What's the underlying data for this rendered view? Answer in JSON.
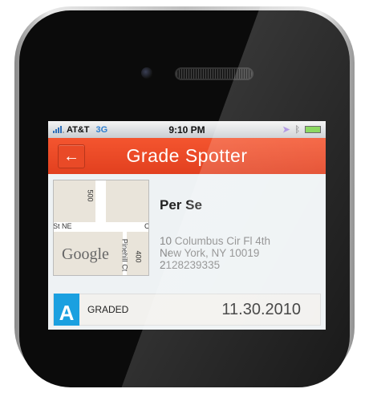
{
  "status_bar": {
    "carrier": "AT&T",
    "network": "3G",
    "time": "9:10 PM",
    "icons": [
      "signal-icon",
      "location-arrow-icon",
      "bluetooth-icon",
      "battery-charging-icon"
    ]
  },
  "header": {
    "title": "Grade Spotter",
    "back_icon": "arrow-left-icon",
    "color": "#e94a27"
  },
  "restaurant": {
    "name": "Per Se",
    "address_line1": "10 Columbus Cir Fl 4th",
    "address_line2": "New York, NY 10019",
    "phone": "2128239335",
    "map": {
      "labels": [
        "500",
        "St NE",
        "Pinehill Ct",
        "400",
        "C"
      ],
      "logo": "Google"
    }
  },
  "inspection": {
    "grade": "A",
    "status": "GRADED",
    "date": "11.30.2010",
    "grade_color": "#1aa0e0"
  }
}
